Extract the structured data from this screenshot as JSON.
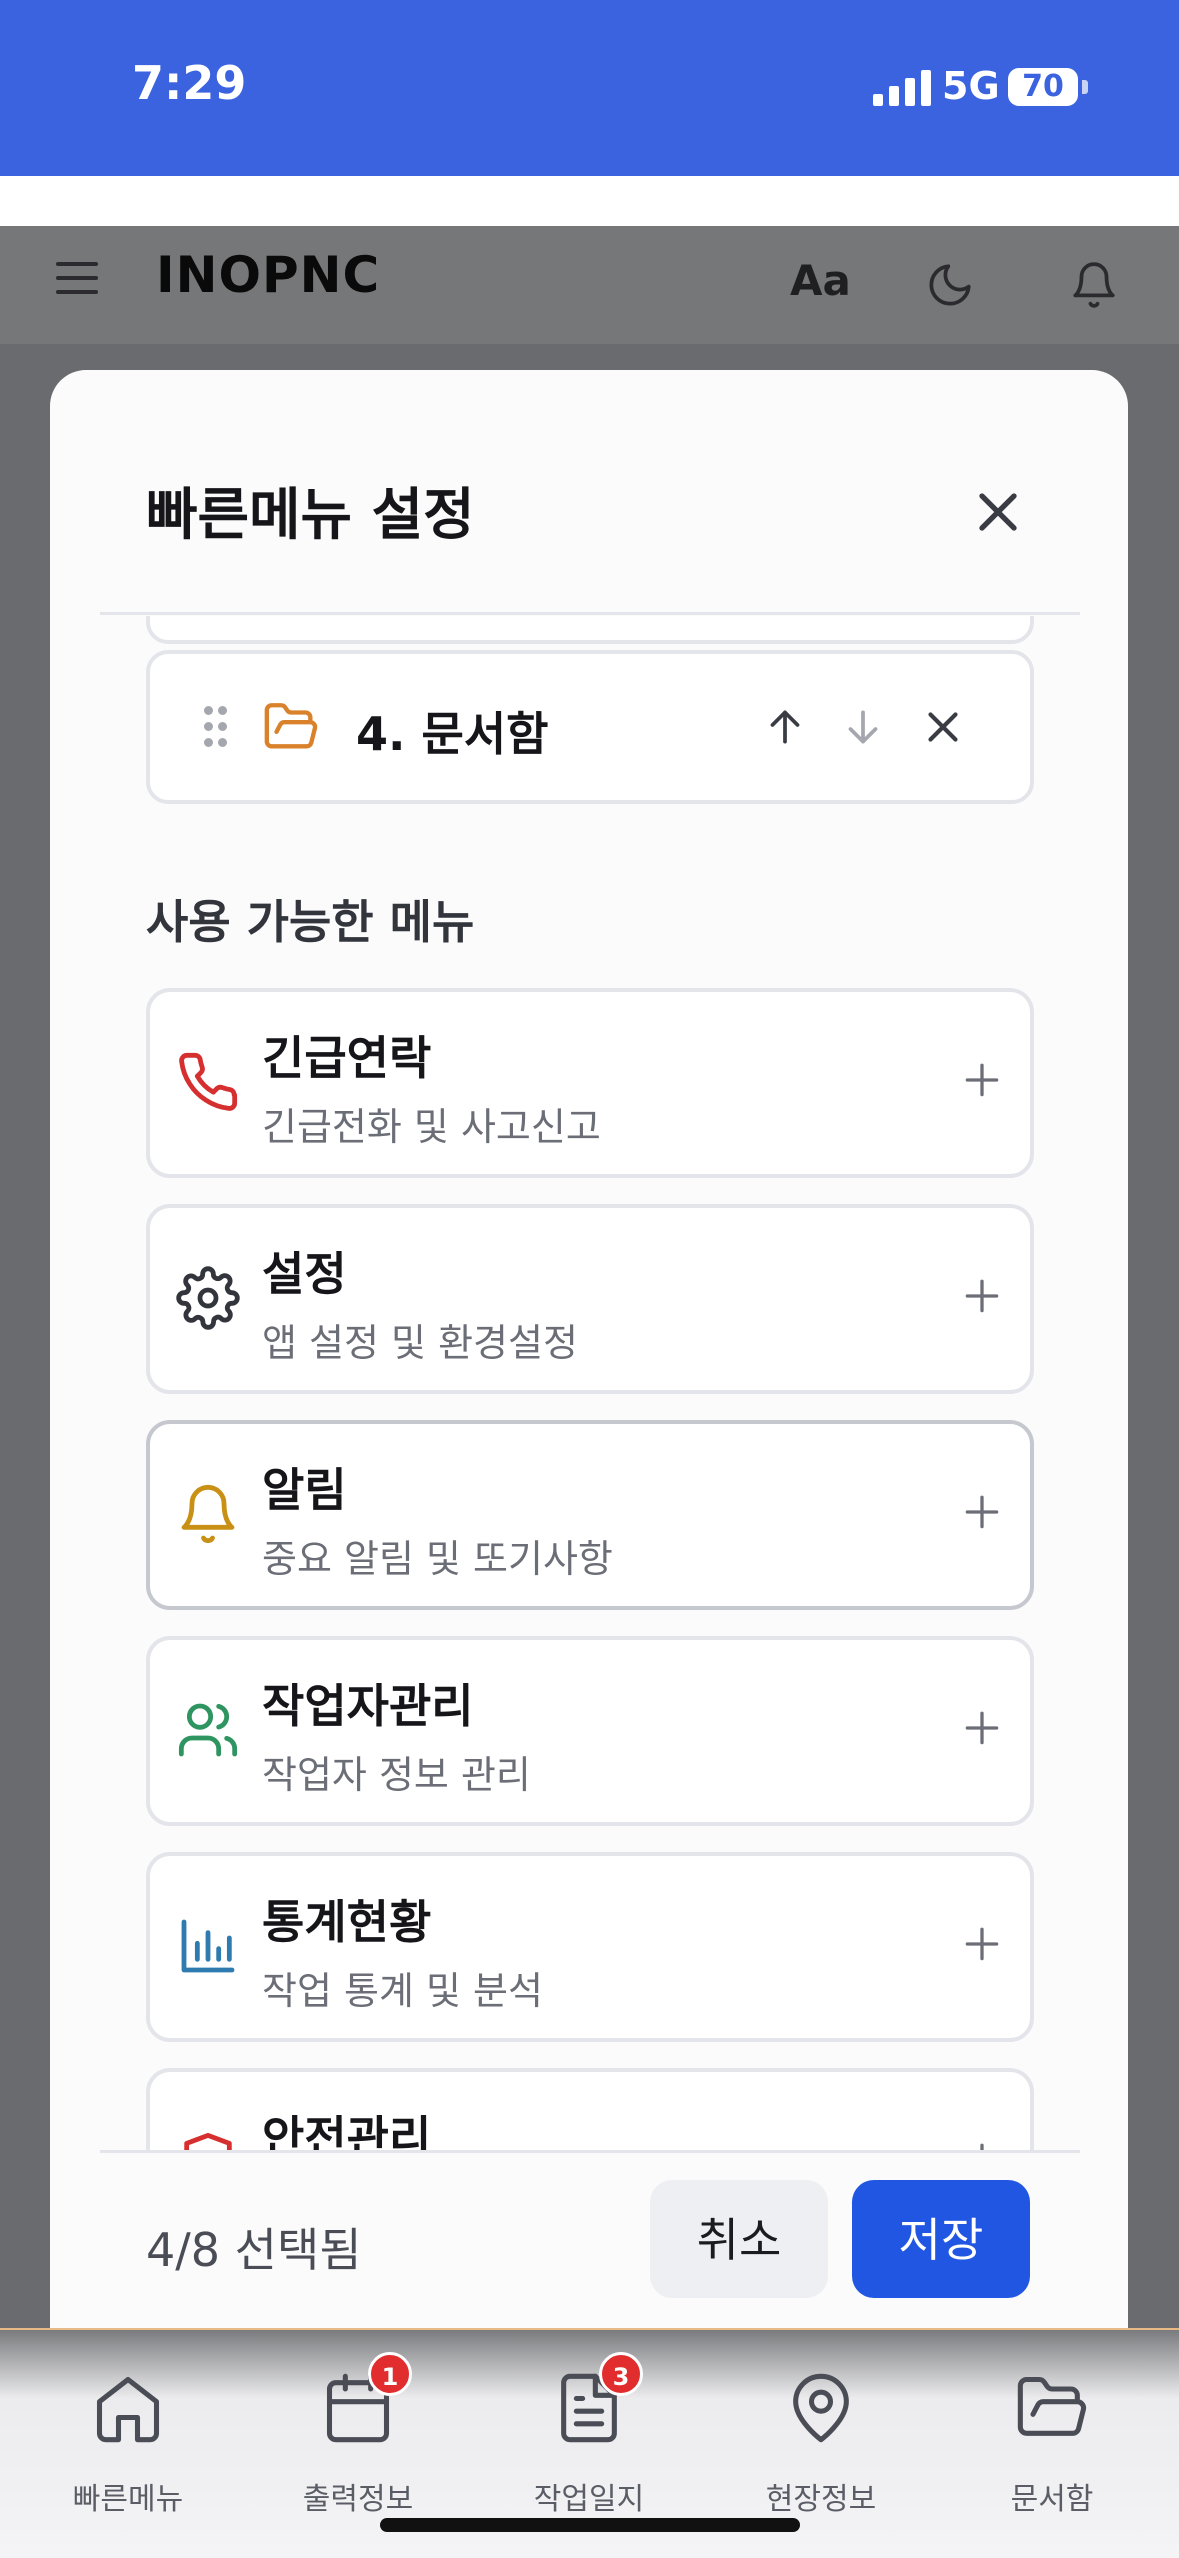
{
  "status_bar": {
    "time": "7:29",
    "network": "5G",
    "battery": "70"
  },
  "header": {
    "brand": "INOPNC",
    "font_size_label": "Aa"
  },
  "modal": {
    "title": "빠른메뉴 설정",
    "selected_items": [
      {
        "label": "4. 문서함",
        "icon": "folder-icon",
        "color": "#d9822b"
      }
    ],
    "available_title": "사용 가능한 메뉴",
    "available_items": [
      {
        "title": "긴급연락",
        "subtitle": "긴급전화 및 사고신고",
        "icon": "phone-icon",
        "color": "#d62f2f"
      },
      {
        "title": "설정",
        "subtitle": "앱 설정 및 환경설정",
        "icon": "gear-icon",
        "color": "#33353c"
      },
      {
        "title": "알림",
        "subtitle": "중요 알림 및 또기사항",
        "icon": "bell-icon",
        "color": "#c99016"
      },
      {
        "title": "작업자관리",
        "subtitle": "작업자 정보 관리",
        "icon": "users-icon",
        "color": "#2e9460"
      },
      {
        "title": "통계현황",
        "subtitle": "작업 통계 및 분석",
        "icon": "bar-chart-icon",
        "color": "#2f7bb0"
      },
      {
        "title": "안전관리",
        "subtitle": "",
        "icon": "safety-icon",
        "color": "#d62f2f"
      }
    ],
    "selection_count": "4/8 선택됨",
    "cancel_label": "취소",
    "save_label": "저장"
  },
  "bottom_nav": [
    {
      "label": "빠른메뉴",
      "icon": "home-icon",
      "badge": ""
    },
    {
      "label": "출력정보",
      "icon": "calendar-icon",
      "badge": "1"
    },
    {
      "label": "작업일지",
      "icon": "document-icon",
      "badge": "3"
    },
    {
      "label": "현장정보",
      "icon": "map-pin-icon",
      "badge": ""
    },
    {
      "label": "문서함",
      "icon": "folder-icon",
      "badge": ""
    }
  ],
  "colors": {
    "accent": "#2156e3",
    "status_bar": "#3b63e0",
    "badge": "#e12d2d"
  }
}
